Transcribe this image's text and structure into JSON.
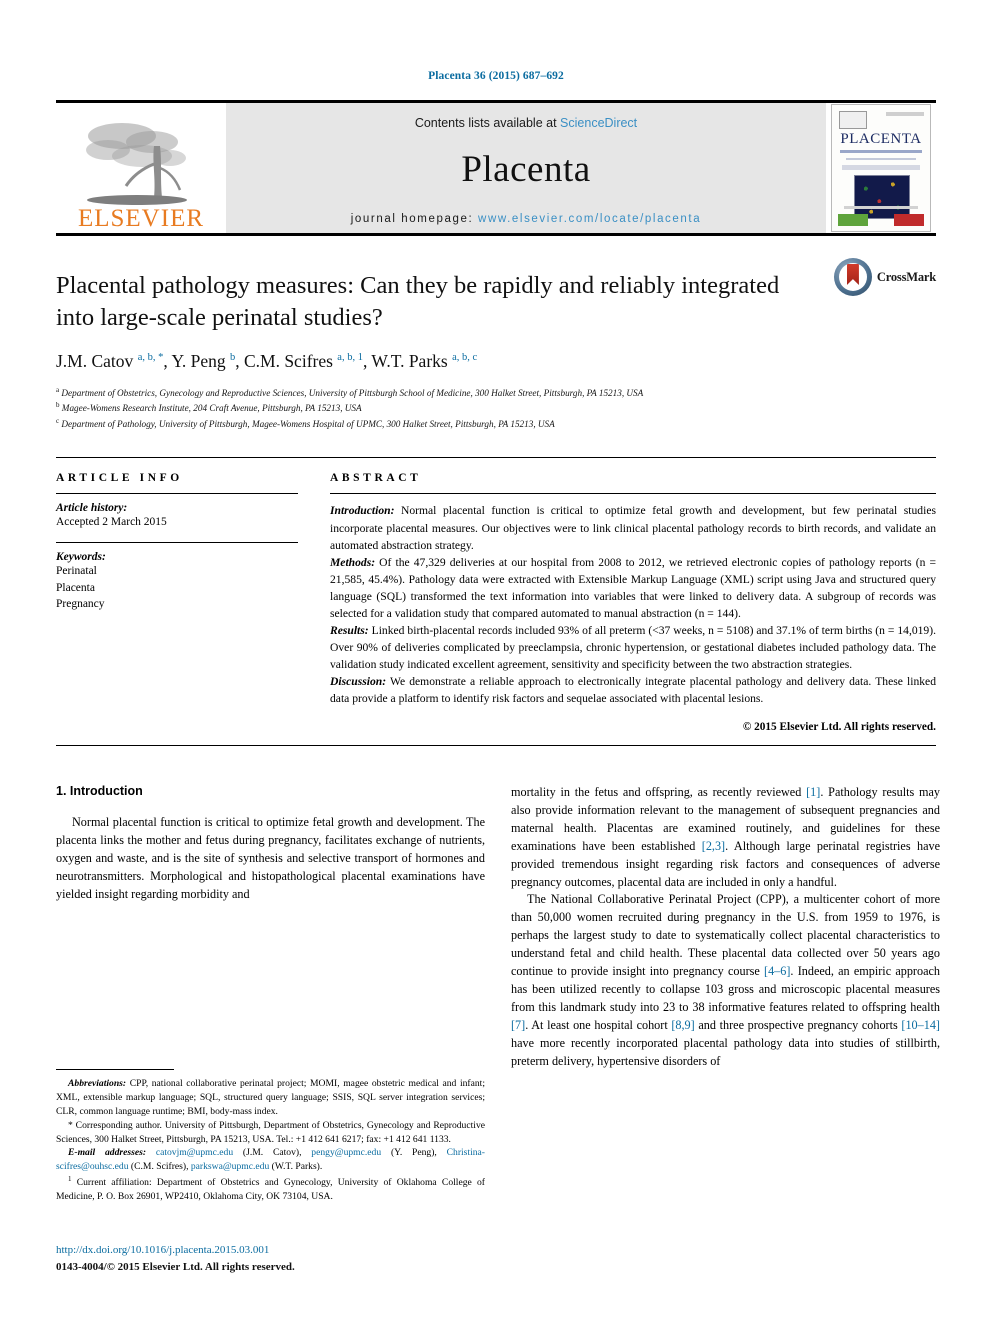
{
  "running_head": "Placenta 36 (2015) 687–692",
  "masthead": {
    "publisher_logo_text": "ELSEVIER",
    "contents_prefix": "Contents lists available at",
    "contents_link": "ScienceDirect",
    "journal_name": "Placenta",
    "homepage_prefix": "journal homepage:",
    "homepage_url": "www.elsevier.com/locate/placenta",
    "cover_title": "PLACENTA"
  },
  "article": {
    "title": "Placental pathology measures: Can they be rapidly and reliably integrated into large-scale perinatal studies?",
    "authors_html": "J.M. Catov <sup>a, b, *</sup>, Y. Peng <sup>b</sup>, C.M. Scifres <sup>a, b, 1</sup>, W.T. Parks <sup>a, b, c</sup>",
    "affiliations": [
      "Department of Obstetrics, Gynecology and Reproductive Sciences, University of Pittsburgh School of Medicine, 300 Halket Street, Pittsburgh, PA 15213, USA",
      "Magee-Womens Research Institute, 204 Craft Avenue, Pittsburgh, PA 15213, USA",
      "Department of Pathology, University of Pittsburgh, Magee-Womens Hospital of UPMC, 300 Halket Street, Pittsburgh, PA 15213, USA"
    ],
    "affiliation_marks": [
      "a",
      "b",
      "c"
    ],
    "crossmark_label": "CrossMark"
  },
  "article_info": {
    "heading": "ARTICLE INFO",
    "history_label": "Article history:",
    "history_value": "Accepted 2 March 2015",
    "keywords_label": "Keywords:",
    "keywords": [
      "Perinatal",
      "Placenta",
      "Pregnancy"
    ]
  },
  "abstract": {
    "heading": "ABSTRACT",
    "sections": [
      {
        "label": "Introduction:",
        "text": " Normal placental function is critical to optimize fetal growth and development, but few perinatal studies incorporate placental measures. Our objectives were to link clinical placental pathology records to birth records, and validate an automated abstraction strategy."
      },
      {
        "label": "Methods:",
        "text": " Of the 47,329 deliveries at our hospital from 2008 to 2012, we retrieved electronic copies of pathology reports (n = 21,585, 45.4%). Pathology data were extracted with Extensible Markup Language (XML) script using Java and structured query language (SQL) transformed the text information into variables that were linked to delivery data. A subgroup of records was selected for a validation study that compared automated to manual abstraction (n = 144)."
      },
      {
        "label": "Results:",
        "text": " Linked birth-placental records included 93% of all preterm (<37 weeks, n = 5108) and 37.1% of term births (n = 14,019). Over 90% of deliveries complicated by preeclampsia, chronic hypertension, or gestational diabetes included pathology data. The validation study indicated excellent agreement, sensitivity and specificity between the two abstraction strategies."
      },
      {
        "label": "Discussion:",
        "text": " We demonstrate a reliable approach to electronically integrate placental pathology and delivery data. These linked data provide a platform to identify risk factors and sequelae associated with placental lesions."
      }
    ],
    "copyright": "© 2015 Elsevier Ltd. All rights reserved."
  },
  "body": {
    "section_heading": "1. Introduction",
    "left_paragraphs": [
      "Normal placental function is critical to optimize fetal growth and development. The placenta links the mother and fetus during pregnancy, facilitates exchange of nutrients, oxygen and waste, and is the site of synthesis and selective transport of hormones and neurotransmitters. Morphological and histopathological placental examinations have yielded insight regarding morbidity and"
    ],
    "right_paragraphs": [
      {
        "indent": false,
        "runs": [
          {
            "t": "mortality in the fetus and offspring, as recently reviewed "
          },
          {
            "t": "[1]",
            "ref": true
          },
          {
            "t": ". Pathology results may also provide information relevant to the management of subsequent pregnancies and maternal health. Placentas are examined routinely, and guidelines for these examinations have been established "
          },
          {
            "t": "[2,3]",
            "ref": true
          },
          {
            "t": ". Although large perinatal registries have provided tremendous insight regarding risk factors and consequences of adverse pregnancy outcomes, placental data are included in only a handful."
          }
        ]
      },
      {
        "indent": true,
        "runs": [
          {
            "t": "The National Collaborative Perinatal Project (CPP), a multicenter cohort of more than 50,000 women recruited during pregnancy in the U.S. from 1959 to 1976, is perhaps the largest study to date to systematically collect placental characteristics to understand fetal and child health. These placental data collected over 50 years ago continue to provide insight into pregnancy course "
          },
          {
            "t": "[4–6]",
            "ref": true
          },
          {
            "t": ". Indeed, an empiric approach has been utilized recently to collapse 103 gross and microscopic placental measures from this landmark study into 23 to 38 informative features related to offspring health "
          },
          {
            "t": "[7]",
            "ref": true
          },
          {
            "t": ". At least one hospital cohort "
          },
          {
            "t": "[8,9]",
            "ref": true
          },
          {
            "t": " and three prospective pregnancy cohorts "
          },
          {
            "t": "[10–14]",
            "ref": true
          },
          {
            "t": " have more recently incorporated placental pathology data into studies of stillbirth, preterm delivery, hypertensive disorders of"
          }
        ]
      }
    ]
  },
  "footnotes": {
    "abbreviations_label": "Abbreviations:",
    "abbreviations_text": " CPP, national collaborative perinatal project; MOMI, magee obstetric medical and infant; XML, extensible markup language; SQL, structured query language; SSIS, SQL server integration services; CLR, common language runtime; BMI, body-mass index.",
    "corresponding_mark": "*",
    "corresponding_text": " Corresponding author. University of Pittsburgh, Department of Obstetrics, Gynecology and Reproductive Sciences, 300 Halket Street, Pittsburgh, PA 15213, USA. Tel.: +1 412 641 6217; fax: +1 412 641 1133.",
    "email_label": "E-mail addresses:",
    "emails": [
      {
        "address": "catovjm@upmc.edu",
        "owner": "(J.M. Catov)"
      },
      {
        "address": "pengy@upmc.edu",
        "owner": "(Y. Peng)"
      },
      {
        "address": "Christina-scifres@ouhsc.edu",
        "owner": "(C.M. Scifres)"
      },
      {
        "address": "parkswa@upmc.edu",
        "owner": "(W.T. Parks)"
      }
    ],
    "current_affil_mark": "1",
    "current_affil_text": " Current affiliation: Department of Obstetrics and Gynecology, University of Oklahoma College of Medicine, P. O. Box 26901, WP2410, Oklahoma City, OK 73104, USA."
  },
  "doi": {
    "url": "http://dx.doi.org/10.1016/j.placenta.2015.03.001",
    "issn_line": "0143-4004/© 2015 Elsevier Ltd. All rights reserved."
  }
}
